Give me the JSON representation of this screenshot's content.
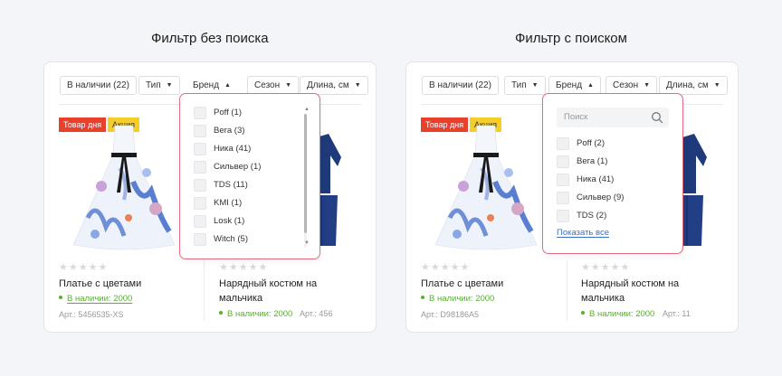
{
  "left": {
    "title": "Фильтр без поиска",
    "filters": [
      "В наличии (22)",
      "Тип",
      "Бренд",
      "Сезон",
      "Длина, см"
    ],
    "badges": {
      "red": "Товар дня",
      "yellow": "Акция"
    },
    "product1": {
      "stars": "★★★★★",
      "name": "Платье с цветами",
      "stock": "В наличии: 2000",
      "sku": "Арт.: 5456535-XS"
    },
    "product2": {
      "stars": "★★★★★",
      "name_line1": "Нарядный костюм на",
      "name_line2": "мальчика",
      "stock": "В наличии: 2000",
      "sku": "Арт.: 456"
    },
    "dropdown": {
      "items": [
        "Poff (1)",
        "Вега (3)",
        "Ника (41)",
        "Сильвер (1)",
        "TDS (11)",
        "KMI (1)",
        "Losk (1)",
        "Witch (5)"
      ],
      "scroll_up": "▲",
      "scroll_down": "▼"
    }
  },
  "right": {
    "title": "Фильтр с поиском",
    "filters": [
      "В наличии (22)",
      "Тип",
      "Бренд",
      "Сезон",
      "Длина, см"
    ],
    "badges": {
      "red": "Товар дня",
      "yellow": "Акция"
    },
    "product1": {
      "stars": "★★★★★",
      "name": "Платье с цветами",
      "stock": "В наличии: 2000",
      "sku": "Арт.: D98186A5"
    },
    "product2": {
      "stars": "★★★★★",
      "name_line1": "Нарядный костюм на",
      "name_line2": "мальчика",
      "stock": "В наличии: 2000",
      "sku": "Арт.: 11"
    },
    "dropdown": {
      "search_placeholder": "Поиск",
      "items": [
        "Poff (2)",
        "Вега (1)",
        "Ника (41)",
        "Сильвер (9)",
        "TDS (2)"
      ],
      "show_all": "Показать все"
    }
  },
  "carets": {
    "down": "▼",
    "up": "▲"
  },
  "colors": {
    "accent_border": "#e36b7e",
    "badge_red": "#e9402c",
    "badge_yellow": "#f6ce2a",
    "stock_green": "#52b426",
    "link_blue": "#3a6fc4"
  }
}
